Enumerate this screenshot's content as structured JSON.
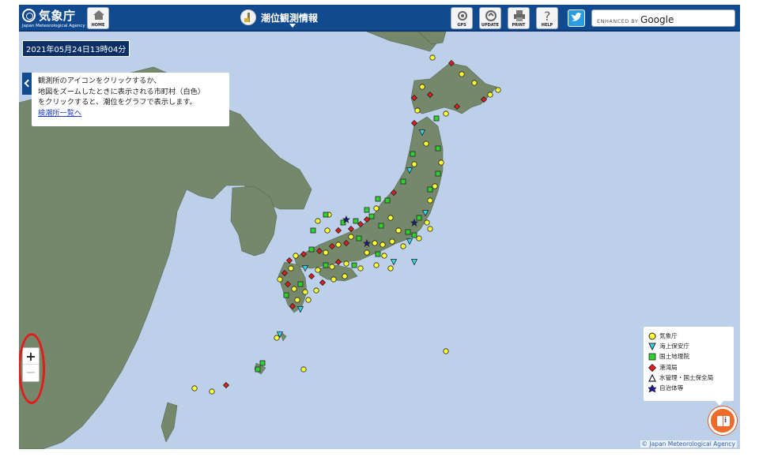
{
  "header": {
    "logo_text": "気象庁",
    "logo_subtext": "Japan Meteorological Agency",
    "home_label": "HOME",
    "title": "潮位観測情報",
    "gps_label": "GPS",
    "update_label": "UPDATE",
    "print_label": "PRINT",
    "help_label": "HELP",
    "search_prefix": "ENHANCED BY",
    "search_brand": "Google"
  },
  "datetime": "2021年05月24日13時04分",
  "info": {
    "line1": "観測所のアイコンをクリックするか、",
    "line2": "地図をズームしたときに表示される市町村（白色）",
    "line3": "をクリックすると、潮位をグラフで表示します。",
    "link": "検潮所一覧へ"
  },
  "zoom": {
    "in": "+",
    "out": "−"
  },
  "legend": {
    "items": [
      {
        "label": "気象庁",
        "color": "#ffff33",
        "icon": "circle"
      },
      {
        "label": "海上保安庁",
        "color": "#33d6e8",
        "icon": "triangle-down"
      },
      {
        "label": "国土地理院",
        "color": "#2ed12e",
        "icon": "square"
      },
      {
        "label": "港湾局",
        "color": "#e01c1c",
        "icon": "diamond"
      },
      {
        "label": "水管理・国土保全局",
        "color": "#ffffff",
        "icon": "triangle-up"
      },
      {
        "label": "自治体等",
        "color": "#1a1a8c",
        "icon": "star"
      }
    ]
  },
  "copyright": "© Japan Meteorological Agency",
  "colors": {
    "header_bg": "#124a8f",
    "sea": "#bcd0ea",
    "land": "#75886c",
    "highlight_ring": "#e21b1b"
  }
}
